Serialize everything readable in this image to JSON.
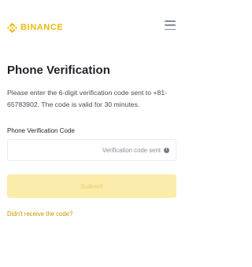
{
  "header": {
    "brand": "BINANCE",
    "brand_color": "#F0B90B",
    "logo_icon": "binance-logo-icon",
    "menu_icon": "hamburger-menu-icon"
  },
  "main": {
    "title": "Phone Verification",
    "description": "Please enter the 6-digit verification code sent to +81-65783902. The code is valid for 30 minutes.",
    "field": {
      "label": "Phone Verification Code",
      "value": "",
      "hint": "Verification code sent",
      "hint_icon": "info-icon",
      "hint_icon_glyph": "!"
    },
    "submit_label": "Submit",
    "submit_enabled": false,
    "resend_link": "Didn't receive the code?"
  }
}
